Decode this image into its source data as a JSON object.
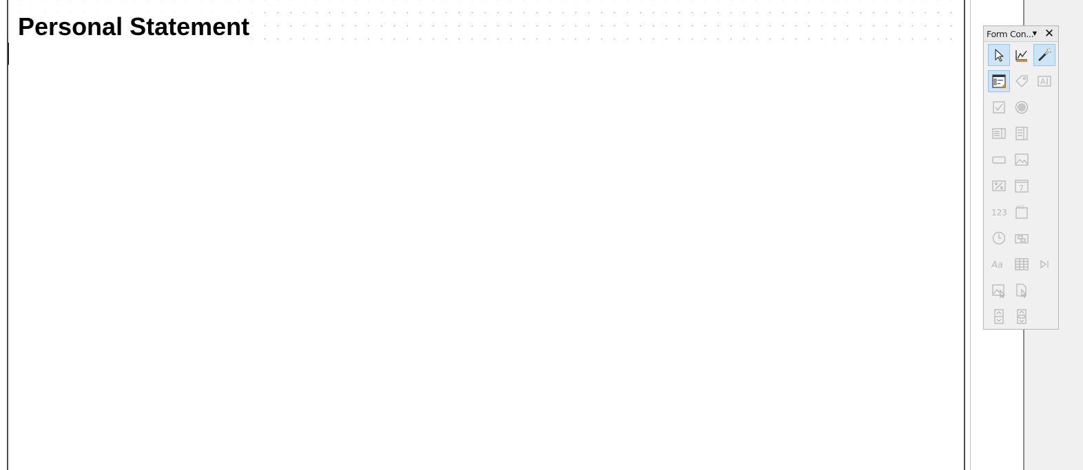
{
  "document": {
    "heading": "Personal Statement"
  },
  "form_controls_toolbar": {
    "title": "Form Con...",
    "menu_glyph": "▼",
    "close_glyph": "✕",
    "buttons": [
      {
        "name": "select-icon",
        "label": "Select",
        "enabled": true,
        "active": true
      },
      {
        "name": "design-mode-icon",
        "label": "Design Mode",
        "enabled": true,
        "active": false
      },
      {
        "name": "control-wizards-icon",
        "label": "Wizards On/Off",
        "enabled": true,
        "active": true
      },
      {
        "name": "form-design-icon",
        "label": "Form Design",
        "enabled": true,
        "active": true
      },
      {
        "name": "label-field-icon",
        "label": "Label Field",
        "enabled": false
      },
      {
        "name": "text-box-icon",
        "label": "Text Box",
        "enabled": false
      },
      {
        "name": "check-box-icon",
        "label": "Check Box",
        "enabled": false
      },
      {
        "name": "option-button-icon",
        "label": "Option Button",
        "enabled": false
      },
      {
        "name": "list-box-icon",
        "label": "List Box",
        "enabled": false
      },
      {
        "name": "combo-box-icon",
        "label": "Combo Box",
        "enabled": false
      },
      {
        "name": "push-button-icon",
        "label": "Push Button",
        "enabled": false
      },
      {
        "name": "image-button-icon",
        "label": "Image Button",
        "enabled": false
      },
      {
        "name": "formatted-field-icon",
        "label": "Formatted Field",
        "enabled": false
      },
      {
        "name": "date-field-icon",
        "label": "Date Field",
        "enabled": false
      },
      {
        "name": "numerical-field-icon",
        "label": "Numerical Field",
        "enabled": false,
        "glyph": "123"
      },
      {
        "name": "pattern-field-icon",
        "label": "Pattern Field",
        "enabled": false,
        "glyph": "XYZ"
      },
      {
        "name": "time-field-icon",
        "label": "Time Field",
        "enabled": false
      },
      {
        "name": "currency-field-icon",
        "label": "Currency Field",
        "enabled": false
      },
      {
        "name": "group-box-icon",
        "label": "Group Box",
        "enabled": false,
        "glyph": "Aa"
      },
      {
        "name": "table-control-icon",
        "label": "Table Control",
        "enabled": false
      },
      {
        "name": "navigation-bar-icon",
        "label": "Navigation Bar",
        "enabled": false
      },
      {
        "name": "image-control-icon",
        "label": "Image Control",
        "enabled": false
      },
      {
        "name": "file-selection-icon",
        "label": "File Selection",
        "enabled": false
      },
      {
        "name": "spin-button-icon",
        "label": "Spin Button",
        "enabled": false
      },
      {
        "name": "scrollbar-control-icon",
        "label": "Scrollbar",
        "enabled": false
      }
    ]
  },
  "colors": {
    "active_button_bg": "#cce4f7",
    "active_button_border": "#98c4e8",
    "accent_orange": "#e8892b",
    "toolbar_bg": "#f0f0f0"
  }
}
